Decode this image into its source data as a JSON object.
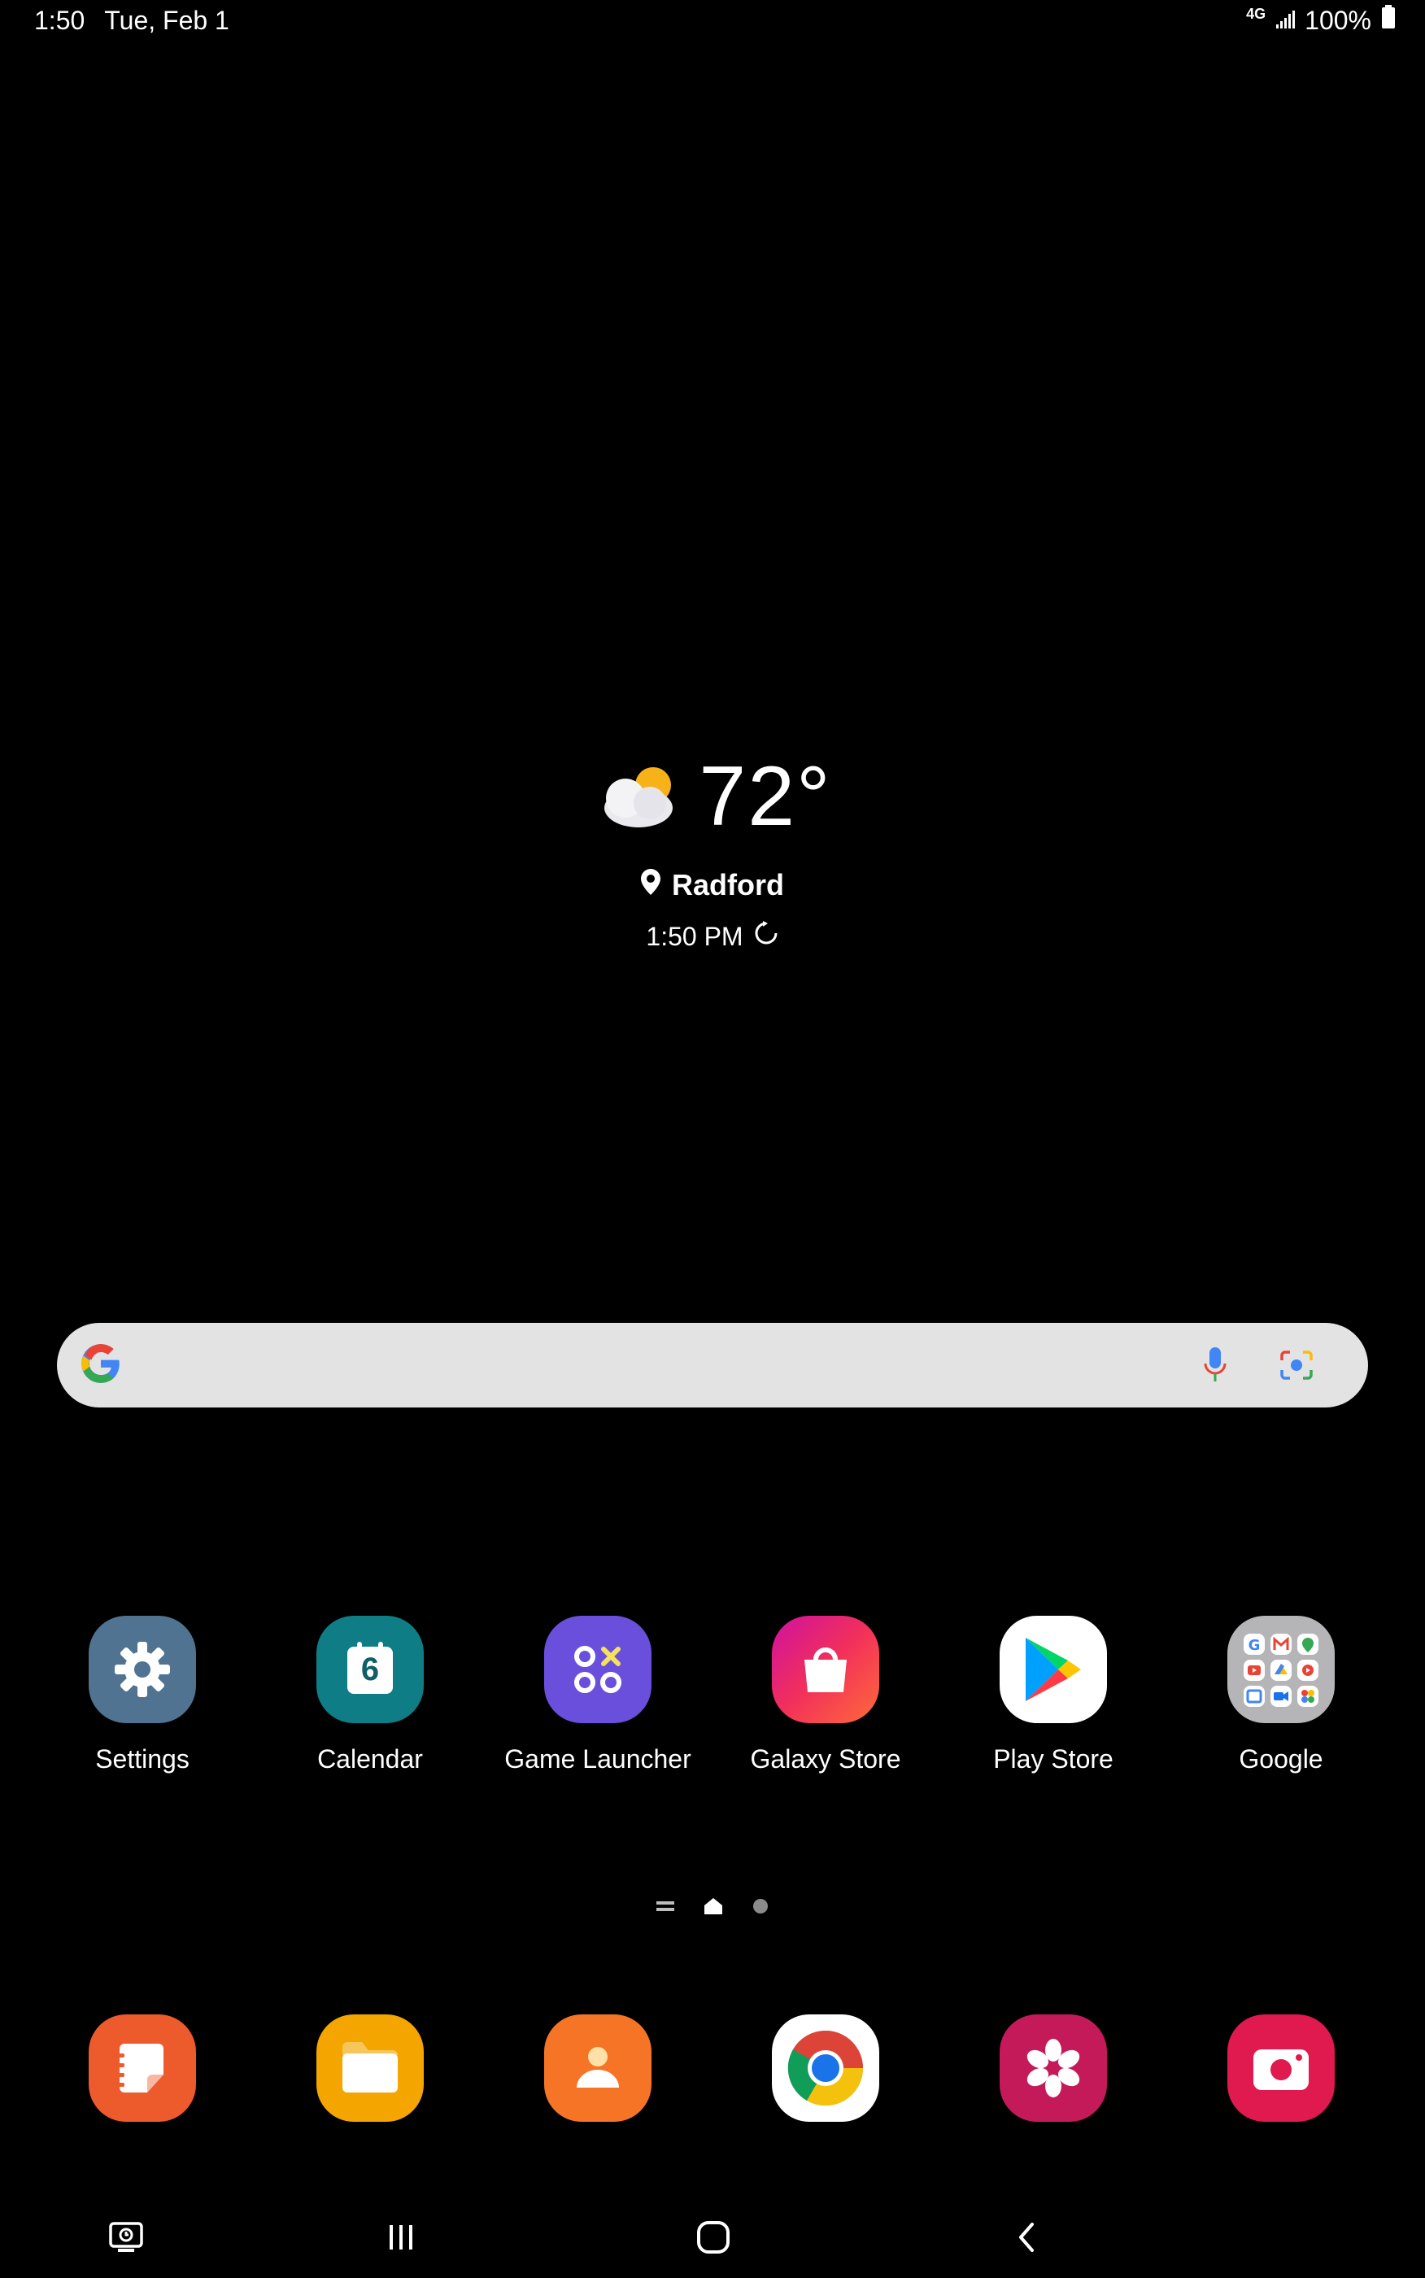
{
  "status_bar": {
    "time": "1:50",
    "date": "Tue, Feb 1",
    "network": "4G",
    "battery": "100%"
  },
  "weather": {
    "temperature": "72°",
    "location": "Radford",
    "updated_time": "1:50 PM"
  },
  "search": {
    "icons": [
      "google-g-icon",
      "microphone-icon",
      "lens-camera-icon"
    ]
  },
  "apps": [
    {
      "label": "Settings",
      "icon": "gear-icon",
      "color": "#4f7390"
    },
    {
      "label": "Calendar",
      "icon": "calendar-icon",
      "color": "#0e7d86",
      "day": "6"
    },
    {
      "label": "Game Launcher",
      "icon": "game-launcher-icon",
      "color": "#6a4fdc"
    },
    {
      "label": "Galaxy Store",
      "icon": "shopping-bag-icon",
      "color": "#e3137a"
    },
    {
      "label": "Play Store",
      "icon": "play-store-icon",
      "color": "#ffffff"
    },
    {
      "label": "Google",
      "icon": "folder-icon",
      "color": "#a9a9aa"
    }
  ],
  "dock": [
    {
      "icon": "samsung-notes-icon",
      "color": "#ed5a2b"
    },
    {
      "icon": "my-files-icon",
      "color": "#f5a500"
    },
    {
      "icon": "contacts-icon",
      "color": "#f57425"
    },
    {
      "icon": "chrome-icon",
      "color": "#ffffff"
    },
    {
      "icon": "gallery-icon",
      "color": "#c51a59"
    },
    {
      "icon": "camera-icon",
      "color": "#e0194e"
    }
  ],
  "page_indicator": {
    "pages": 2,
    "current": "home"
  },
  "nav_bar": {
    "buttons": [
      "screenshot-icon",
      "recents-icon",
      "home-icon",
      "back-icon"
    ]
  }
}
